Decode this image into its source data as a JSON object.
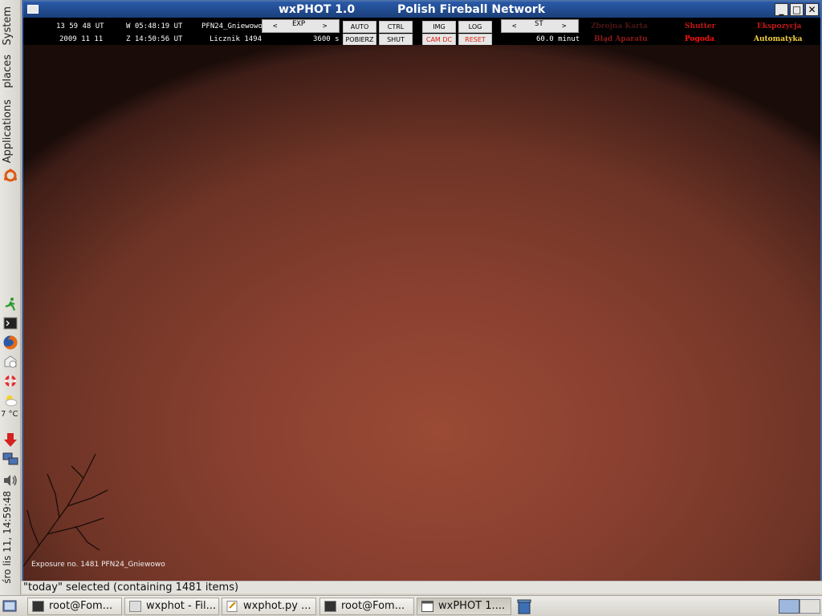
{
  "panel": {
    "system": "System",
    "places": "places",
    "applications": "Applications",
    "temperature": "7 °C",
    "clock": "śro lis 11, 14:59:48"
  },
  "window": {
    "title_left": "wxPHOT 1.0",
    "title_right": "Polish Fireball Network"
  },
  "info": {
    "time_ut": "13 59 48 UT",
    "date": "2009 11 11",
    "w_time": "W 05:48:19 UT",
    "z_time": "Z 14:50:56 UT",
    "station": "PFN24_Gniewowo",
    "counter": "Licznik 1494",
    "exposure_s": "3600 s",
    "minutes": "60.0 minut"
  },
  "controls": {
    "prev": "<",
    "next": ">",
    "exp": "EXP",
    "st": "ST",
    "auto": "AUTO",
    "ctrl": "CTRL",
    "img": "IMG",
    "log": "LOG",
    "pobierz": "POBIERZ",
    "shut": "SHUT",
    "camdc": "CAM DC",
    "reset": "RESET"
  },
  "flags": {
    "zbrojna_karta": "Zbrojna Karta",
    "shutter": "Shutter",
    "ekspozycja": "Ekspozycja",
    "blad_aparatu": "Błąd Aparatu",
    "pogoda": "Pogoda",
    "automatyka": "Automatyka"
  },
  "sky": {
    "caption": "Exposure no. 1481   PFN24_Gniewowo"
  },
  "status_line": "\"today\" selected (containing 1481 items)",
  "taskbar": {
    "items": [
      {
        "label": "root@Fom..."
      },
      {
        "label": "wxphot - Fil..."
      },
      {
        "label": "wxphot.py ..."
      },
      {
        "label": "root@Fom..."
      },
      {
        "label": "wxPHOT 1...."
      }
    ]
  },
  "colors": {
    "title_bar": "#1b3f7a",
    "flag_dim": "#5a1a1a",
    "flag_red": "#e01010",
    "flag_yellow": "#f5d040",
    "sky_center": "#9a4a35"
  }
}
